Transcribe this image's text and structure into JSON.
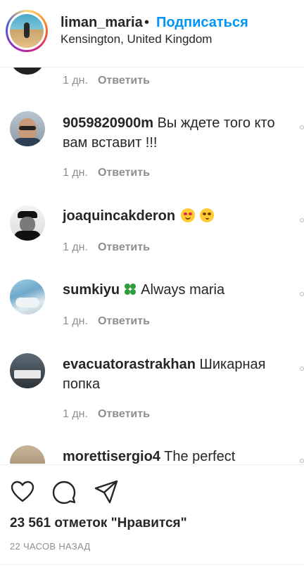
{
  "header": {
    "username": "liman_maria",
    "separator": "•",
    "follow_label": "Подписаться",
    "location": "Kensington, United Kingdom"
  },
  "comments": [
    {
      "user": "",
      "text": "",
      "age": "1 дн.",
      "reply_label": "Ответить"
    },
    {
      "user": "9059820900m",
      "text": " Вы ждете того кто вам вставит !!!",
      "age": "1 дн.",
      "reply_label": "Ответить"
    },
    {
      "user": "joaquincakderon",
      "text": "",
      "age": "1 дн.",
      "reply_label": "Ответить"
    },
    {
      "user": "sumkiyu",
      "text": " Always maria",
      "age": "1 дн.",
      "reply_label": "Ответить"
    },
    {
      "user": "evacuatorastrakhan",
      "text": " Шикарная попка",
      "age": "1 дн.",
      "reply_label": "Ответить"
    },
    {
      "user": "morettisergio4",
      "text": " The perfect",
      "age": "",
      "reply_label": ""
    }
  ],
  "actions": {
    "like_icon": "heart-icon",
    "comment_icon": "comment-icon",
    "share_icon": "share-icon",
    "likes_text": "23 561 отметок \"Нравится\"",
    "time_ago": "22 ЧАСОВ НАЗАД"
  },
  "colors": {
    "accent": "#0095f6",
    "text": "#262626",
    "muted": "#8e8e8e"
  }
}
